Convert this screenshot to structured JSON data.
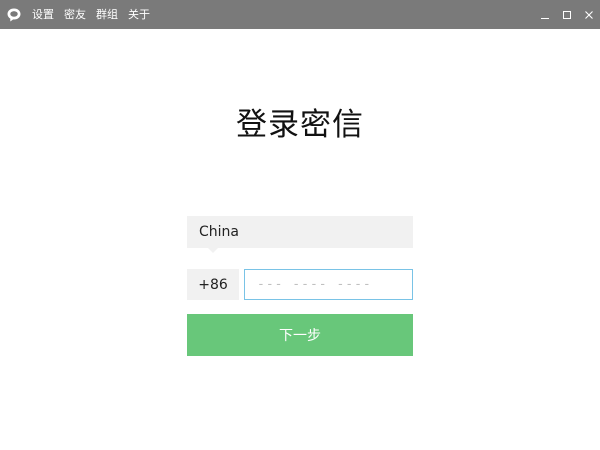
{
  "titlebar": {
    "icon": "chat-bubble-icon",
    "menu": [
      {
        "label": "设置"
      },
      {
        "label": "密友"
      },
      {
        "label": "群组"
      },
      {
        "label": "关于"
      }
    ],
    "controls": [
      "minimize-icon",
      "maximize-icon",
      "close-icon"
    ],
    "background_color": "#7a7a7a"
  },
  "login": {
    "title": "登录密信",
    "country": "China",
    "phone_code": "+86",
    "phone_placeholder": "--- ---- ----",
    "phone_value": "",
    "next_label": "下一步"
  },
  "colors": {
    "accent": "#68c77a",
    "input_focus_border": "#79c3e6",
    "field_background": "#f1f1f1"
  }
}
